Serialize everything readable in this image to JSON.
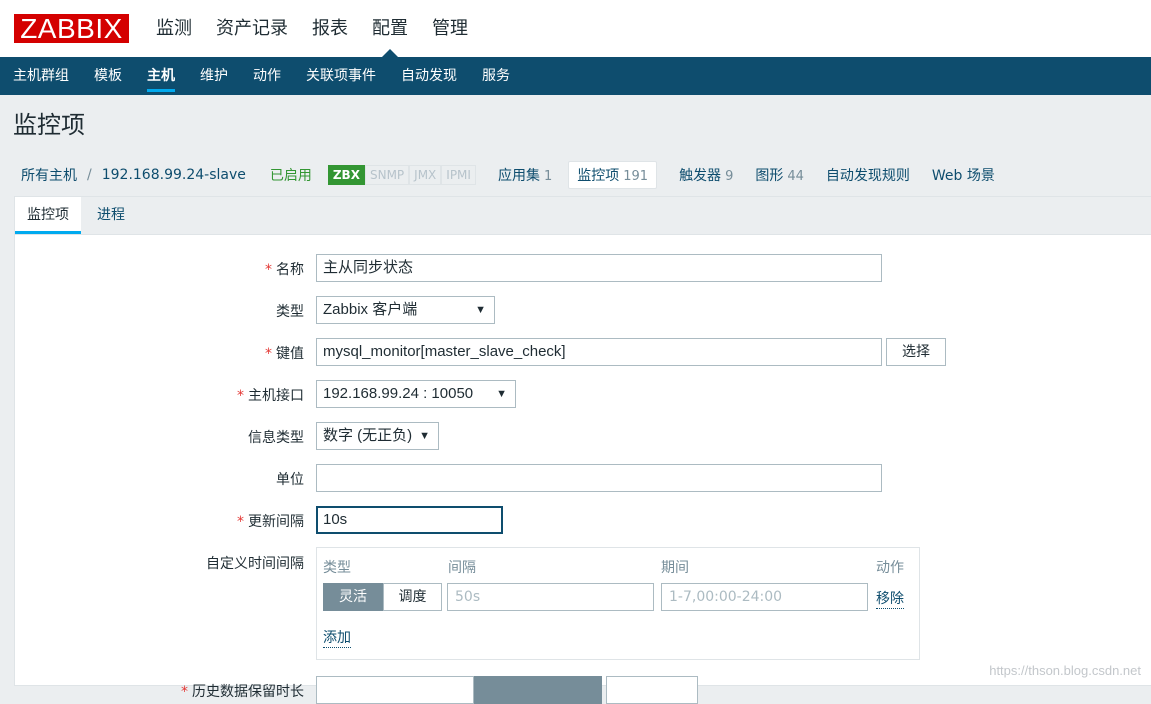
{
  "header": {
    "logo": "ZABBIX",
    "main_menu": [
      "监测",
      "资产记录",
      "报表",
      "配置",
      "管理"
    ],
    "active_main": "配置"
  },
  "subnav": {
    "items": [
      "主机群组",
      "模板",
      "主机",
      "维护",
      "动作",
      "关联项事件",
      "自动发现",
      "服务"
    ],
    "active": "主机"
  },
  "page": {
    "title": "监控项"
  },
  "hostnav": {
    "all_hosts": "所有主机",
    "separator": "/",
    "host": "192.168.99.24-slave",
    "status": "已启用",
    "badges": [
      "ZBX",
      "SNMP",
      "JMX",
      "IPMI"
    ],
    "links": [
      {
        "label": "应用集",
        "count": "1"
      },
      {
        "label": "监控项",
        "count": "191"
      },
      {
        "label": "触发器",
        "count": "9"
      },
      {
        "label": "图形",
        "count": "44"
      },
      {
        "label": "自动发现规则",
        "count": ""
      },
      {
        "label": "Web 场景",
        "count": ""
      }
    ]
  },
  "tabs": [
    "监控项",
    "进程"
  ],
  "form": {
    "name_label": "名称",
    "name_value": "主从同步状态",
    "type_label": "类型",
    "type_value": "Zabbix 客户端",
    "key_label": "键值",
    "key_value": "mysql_monitor[master_slave_check]",
    "select_button": "选择",
    "iface_label": "主机接口",
    "iface_value": "192.168.99.24 : 10050",
    "info_label": "信息类型",
    "info_value": "数字 (无正负)",
    "unit_label": "单位",
    "unit_value": "",
    "interval_label": "更新间隔",
    "interval_value": "10s",
    "custom_label": "自定义时间间隔",
    "history_label": "历史数据保留时长"
  },
  "custom_intervals": {
    "col_type": "类型",
    "col_interval": "间隔",
    "col_period": "期间",
    "col_action": "动作",
    "seg_flexible": "灵活",
    "seg_scheduling": "调度",
    "interval_placeholder": "50s",
    "period_placeholder": "1-7,00:00-24:00",
    "remove": "移除",
    "add": "添加"
  },
  "watermark": "https://thson.blog.csdn.net",
  "colors": {
    "header_bg": "#0e4d6e",
    "logo_bg": "#d40000",
    "enabled": "#339633",
    "required": "#e33734"
  }
}
